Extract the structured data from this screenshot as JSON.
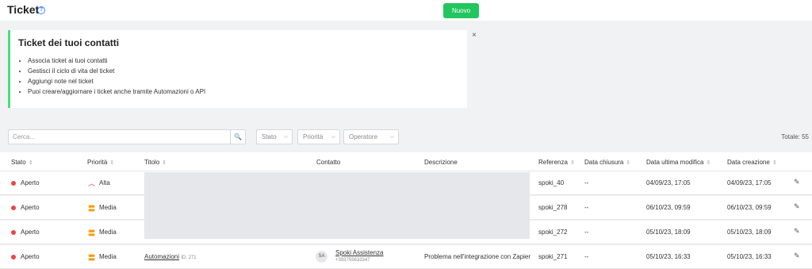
{
  "header": {
    "title": "Ticket",
    "help_icon": "?",
    "new_button": "Nuovo"
  },
  "info": {
    "title": "Ticket dei tuoi contatti",
    "items": [
      "Associa ticket ai tuoi contatti",
      "Gestisci il ciclo di vita del ticket",
      "Aggiungi note nel ticket",
      "Puoi creare/aggiornare i ticket anche tramite Automazioni o API"
    ],
    "close_label": "×"
  },
  "filters": {
    "search_placeholder": "Cerca...",
    "search_icon": "🔍",
    "stato": "Stato",
    "priorita": "Priorità",
    "operatore": "Operatore",
    "chevron": "⌵",
    "total": "Totale: 55"
  },
  "table": {
    "sort_icon": "⇕",
    "columns": {
      "stato": "Stato",
      "priorita": "Priorità",
      "titolo": "Titolo",
      "contatto": "Contatto",
      "descrizione": "Descrizione",
      "referenza": "Referenza",
      "data_chiusura": "Data chiusura",
      "data_ultima_modifica": "Data ultima modifica",
      "data_creazione": "Data creazione"
    },
    "rows": [
      {
        "stato": "Aperto",
        "priorita_icon": "︿",
        "priorita": "Alta",
        "referenza": "spoki_40",
        "data_chiusura": "--",
        "data_modifica": "04/09/23, 17:05",
        "data_creazione": "04/09/23, 17:05"
      },
      {
        "stato": "Aperto",
        "priorita_icon": "〓",
        "priorita": "Media",
        "referenza": "spoki_278",
        "data_chiusura": "--",
        "data_modifica": "06/10/23, 09:59",
        "data_creazione": "06/10/23, 09:59"
      },
      {
        "stato": "Aperto",
        "priorita_icon": "〓",
        "priorita": "Media",
        "referenza": "spoki_272",
        "data_chiusura": "--",
        "data_modifica": "05/10/23, 18:09",
        "data_creazione": "05/10/23, 18:09"
      },
      {
        "stato": "Aperto",
        "priorita_icon": "〓",
        "priorita": "Media",
        "titolo": "Automazioni",
        "titolo_id": "ID: 271",
        "avatar": "SA",
        "contatto_nome": "Spoki Assistenza",
        "contatto_tel": "+393755633347",
        "descrizione": "Problema nell'integrazione con Zapier",
        "referenza": "spoki_271",
        "data_chiusura": "--",
        "data_modifica": "05/10/23, 16:33",
        "data_creazione": "05/10/23, 16:33"
      }
    ],
    "edit_icon": "✎"
  }
}
